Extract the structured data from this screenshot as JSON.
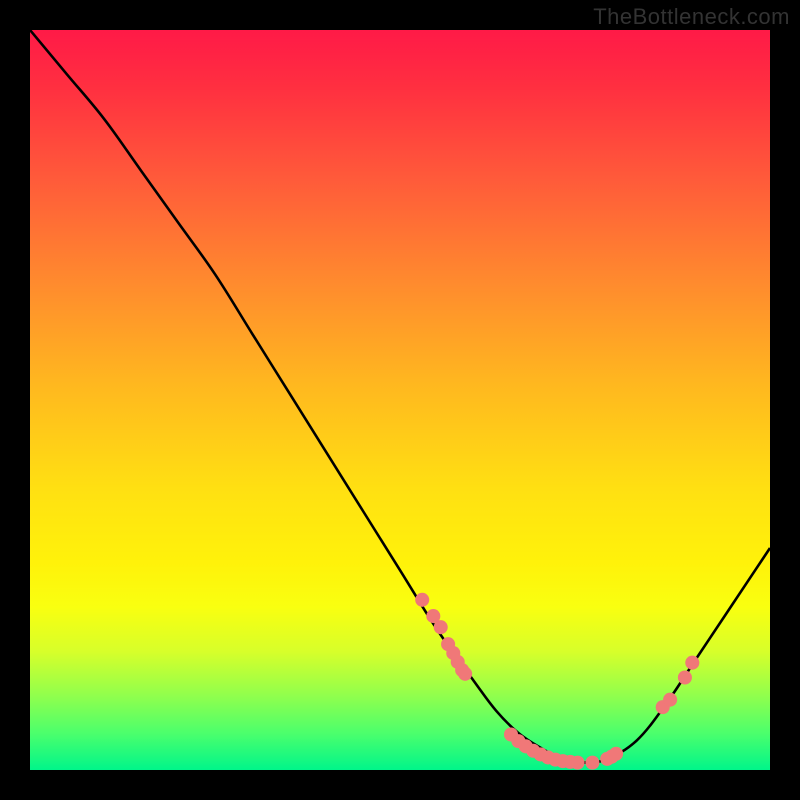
{
  "watermark": "TheBottleneck.com",
  "chart_data": {
    "type": "line",
    "title": "",
    "xlabel": "",
    "ylabel": "",
    "xlim": [
      0,
      100
    ],
    "ylim": [
      0,
      100
    ],
    "series": [
      {
        "name": "curve",
        "x": [
          0,
          5,
          10,
          15,
          20,
          25,
          30,
          35,
          40,
          45,
          50,
          55,
          60,
          63,
          66,
          69,
          72,
          75,
          78,
          82,
          86,
          90,
          94,
          98,
          100
        ],
        "y": [
          100,
          94,
          88,
          81,
          74,
          67,
          59,
          51,
          43,
          35,
          27,
          19,
          12,
          8,
          5,
          3,
          1.5,
          1,
          1.5,
          4,
          9,
          15,
          21,
          27,
          30
        ]
      }
    ],
    "markers": [
      {
        "x": 53.0,
        "y": 23.0
      },
      {
        "x": 54.5,
        "y": 20.8
      },
      {
        "x": 55.5,
        "y": 19.3
      },
      {
        "x": 56.5,
        "y": 17.0
      },
      {
        "x": 57.2,
        "y": 15.8
      },
      {
        "x": 57.8,
        "y": 14.6
      },
      {
        "x": 58.4,
        "y": 13.5
      },
      {
        "x": 58.8,
        "y": 13.0
      },
      {
        "x": 65.0,
        "y": 4.8
      },
      {
        "x": 66.0,
        "y": 3.9
      },
      {
        "x": 67.0,
        "y": 3.2
      },
      {
        "x": 68.0,
        "y": 2.6
      },
      {
        "x": 69.0,
        "y": 2.1
      },
      {
        "x": 70.0,
        "y": 1.7
      },
      {
        "x": 71.0,
        "y": 1.4
      },
      {
        "x": 72.0,
        "y": 1.2
      },
      {
        "x": 73.0,
        "y": 1.1
      },
      {
        "x": 74.0,
        "y": 1.0
      },
      {
        "x": 76.0,
        "y": 1.0
      },
      {
        "x": 78.0,
        "y": 1.5
      },
      {
        "x": 78.6,
        "y": 1.8
      },
      {
        "x": 79.2,
        "y": 2.2
      },
      {
        "x": 85.5,
        "y": 8.5
      },
      {
        "x": 86.5,
        "y": 9.5
      },
      {
        "x": 88.5,
        "y": 12.5
      },
      {
        "x": 89.5,
        "y": 14.5
      }
    ],
    "gradient_stops": [
      {
        "pos": 0,
        "color": "#ff1a47"
      },
      {
        "pos": 8,
        "color": "#ff3040"
      },
      {
        "pos": 20,
        "color": "#ff5a3a"
      },
      {
        "pos": 34,
        "color": "#ff8a2e"
      },
      {
        "pos": 48,
        "color": "#ffb81f"
      },
      {
        "pos": 62,
        "color": "#ffe012"
      },
      {
        "pos": 72,
        "color": "#fff20a"
      },
      {
        "pos": 78,
        "color": "#f9ff10"
      },
      {
        "pos": 84,
        "color": "#d7ff2a"
      },
      {
        "pos": 90,
        "color": "#90ff4d"
      },
      {
        "pos": 95,
        "color": "#4cff6c"
      },
      {
        "pos": 100,
        "color": "#00f58a"
      }
    ],
    "marker_color": "#f07878",
    "line_color": "#000000"
  }
}
